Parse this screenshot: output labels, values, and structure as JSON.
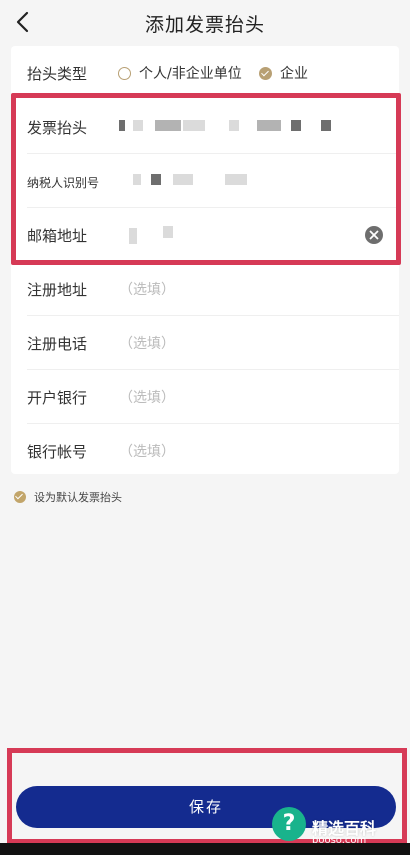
{
  "header": {
    "title": "添加发票抬头"
  },
  "type_row": {
    "label": "抬头类型",
    "options": [
      "个人/非企业单位",
      "企业"
    ],
    "selected": "企业"
  },
  "fields": [
    {
      "label": "发票抬头",
      "value": ""
    },
    {
      "label": "纳税人识别号",
      "value": ""
    },
    {
      "label": "邮箱地址",
      "value": ""
    },
    {
      "label": "注册地址",
      "placeholder": "（选填）"
    },
    {
      "label": "注册电话",
      "placeholder": "（选填）"
    },
    {
      "label": "开户银行",
      "placeholder": "（选填）"
    },
    {
      "label": "银行帐号",
      "placeholder": "（选填）"
    }
  ],
  "default_checkbox": {
    "label": "设为默认发票抬头",
    "checked": true
  },
  "save_button": {
    "label": "保存"
  },
  "watermark": {
    "brand": "精选百科",
    "domain": "booso.com"
  },
  "colors": {
    "accent": "#b8a074",
    "primary": "#142b8f",
    "highlight": "#d63a56"
  },
  "icons": {
    "back": "chevron-left-icon",
    "clear": "clear-icon",
    "watermark": "question-icon"
  }
}
